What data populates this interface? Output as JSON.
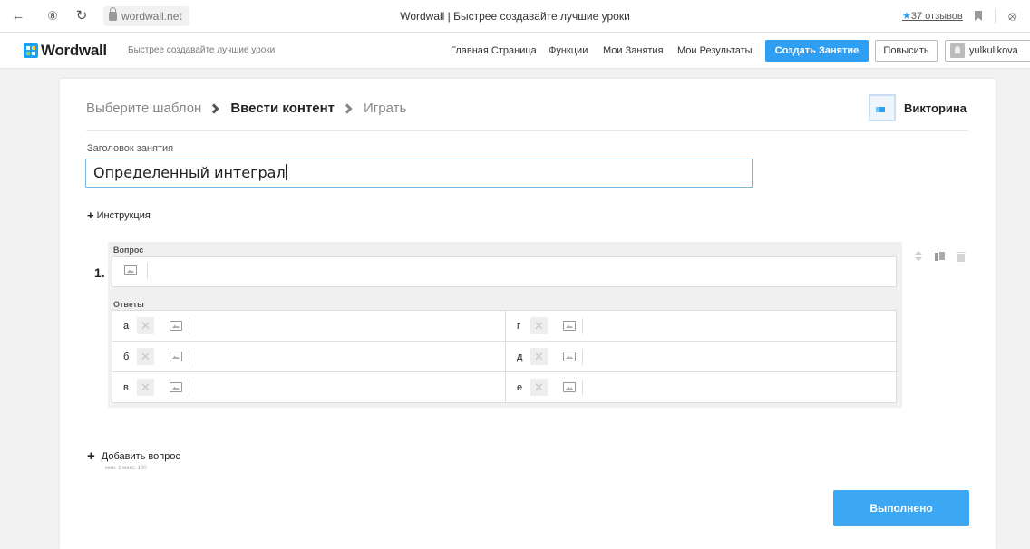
{
  "browser": {
    "url": "wordwall.net",
    "tab_title": "Wordwall | Быстрее создавайте лучшие уроки",
    "reviews": "37 отзывов"
  },
  "header": {
    "logo": "Wordwall",
    "tagline": "Быстрее создавайте лучшие уроки",
    "nav": [
      "Главная Страница",
      "Функции",
      "Мои Занятия",
      "Мои Результаты"
    ],
    "create": "Создать Занятие",
    "upgrade": "Повысить",
    "user": "yulkulikova"
  },
  "steps": [
    "Выберите шаблон",
    "Ввести контент",
    "Играть"
  ],
  "template_name": "Викторина",
  "activity": {
    "label": "Заголовок занятия",
    "title": "Определенный интеграл"
  },
  "instruction": "Инструкция",
  "question": {
    "number": "1.",
    "label": "Вопрос",
    "answers_label": "Ответы",
    "answers": [
      "а",
      "б",
      "в",
      "г",
      "д",
      "е"
    ]
  },
  "add_question": "Добавить вопрос",
  "minmax": "мин. 1   макс. 100",
  "done": "Выполнено",
  "colors": {
    "accent": "#2f9ff3"
  }
}
